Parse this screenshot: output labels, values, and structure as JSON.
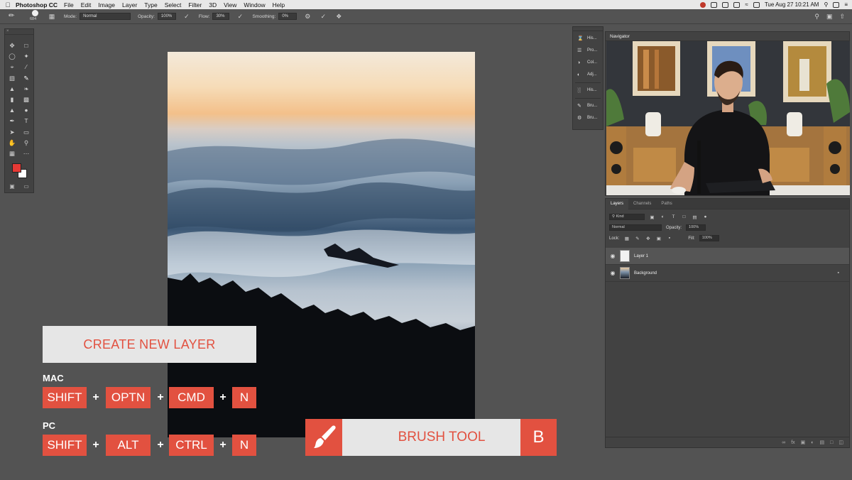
{
  "menubar": {
    "app": "Photoshop CC",
    "items": [
      "File",
      "Edit",
      "Image",
      "Layer",
      "Type",
      "Select",
      "Filter",
      "3D",
      "View",
      "Window",
      "Help"
    ],
    "clock": "Tue Aug 27  10:21 AM"
  },
  "options": {
    "brush_size": "684",
    "mode_label": "Mode:",
    "mode_value": "Normal",
    "opacity_label": "Opacity:",
    "opacity_value": "100%",
    "flow_label": "Flow:",
    "flow_value": "30%",
    "smoothing_label": "Smoothing:",
    "smoothing_value": "0%"
  },
  "side_strip": {
    "items": [
      "His...",
      "Pro...",
      "Col...",
      "Adj...",
      "His...",
      "Bru...",
      "Bru..."
    ]
  },
  "navigator": {
    "title": "Navigator"
  },
  "layers_panel": {
    "tabs": [
      "Layers",
      "Channels",
      "Paths"
    ],
    "filter_kind": "Kind",
    "blend_mode": "Normal",
    "opacity_label": "Opacity:",
    "opacity_value": "100%",
    "lock_label": "Lock:",
    "fill_label": "Fill:",
    "fill_value": "100%",
    "layers": [
      {
        "name": "Layer 1"
      },
      {
        "name": "Background"
      }
    ]
  },
  "overlay": {
    "create_layer_title": "CREATE NEW LAYER",
    "mac_label": "MAC",
    "pc_label": "PC",
    "mac_keys": [
      "SHIFT",
      "OPTN",
      "CMD",
      "N"
    ],
    "pc_keys": [
      "SHIFT",
      "ALT",
      "CTRL",
      "N"
    ],
    "plus": "+",
    "brush_tool_label": "BRUSH TOOL",
    "brush_tool_key": "B"
  },
  "colors": {
    "accent": "#e25140",
    "foreground_swatch": "#e53935",
    "background_swatch": "#ffffff",
    "workspace": "#535353",
    "panel": "#424242"
  }
}
